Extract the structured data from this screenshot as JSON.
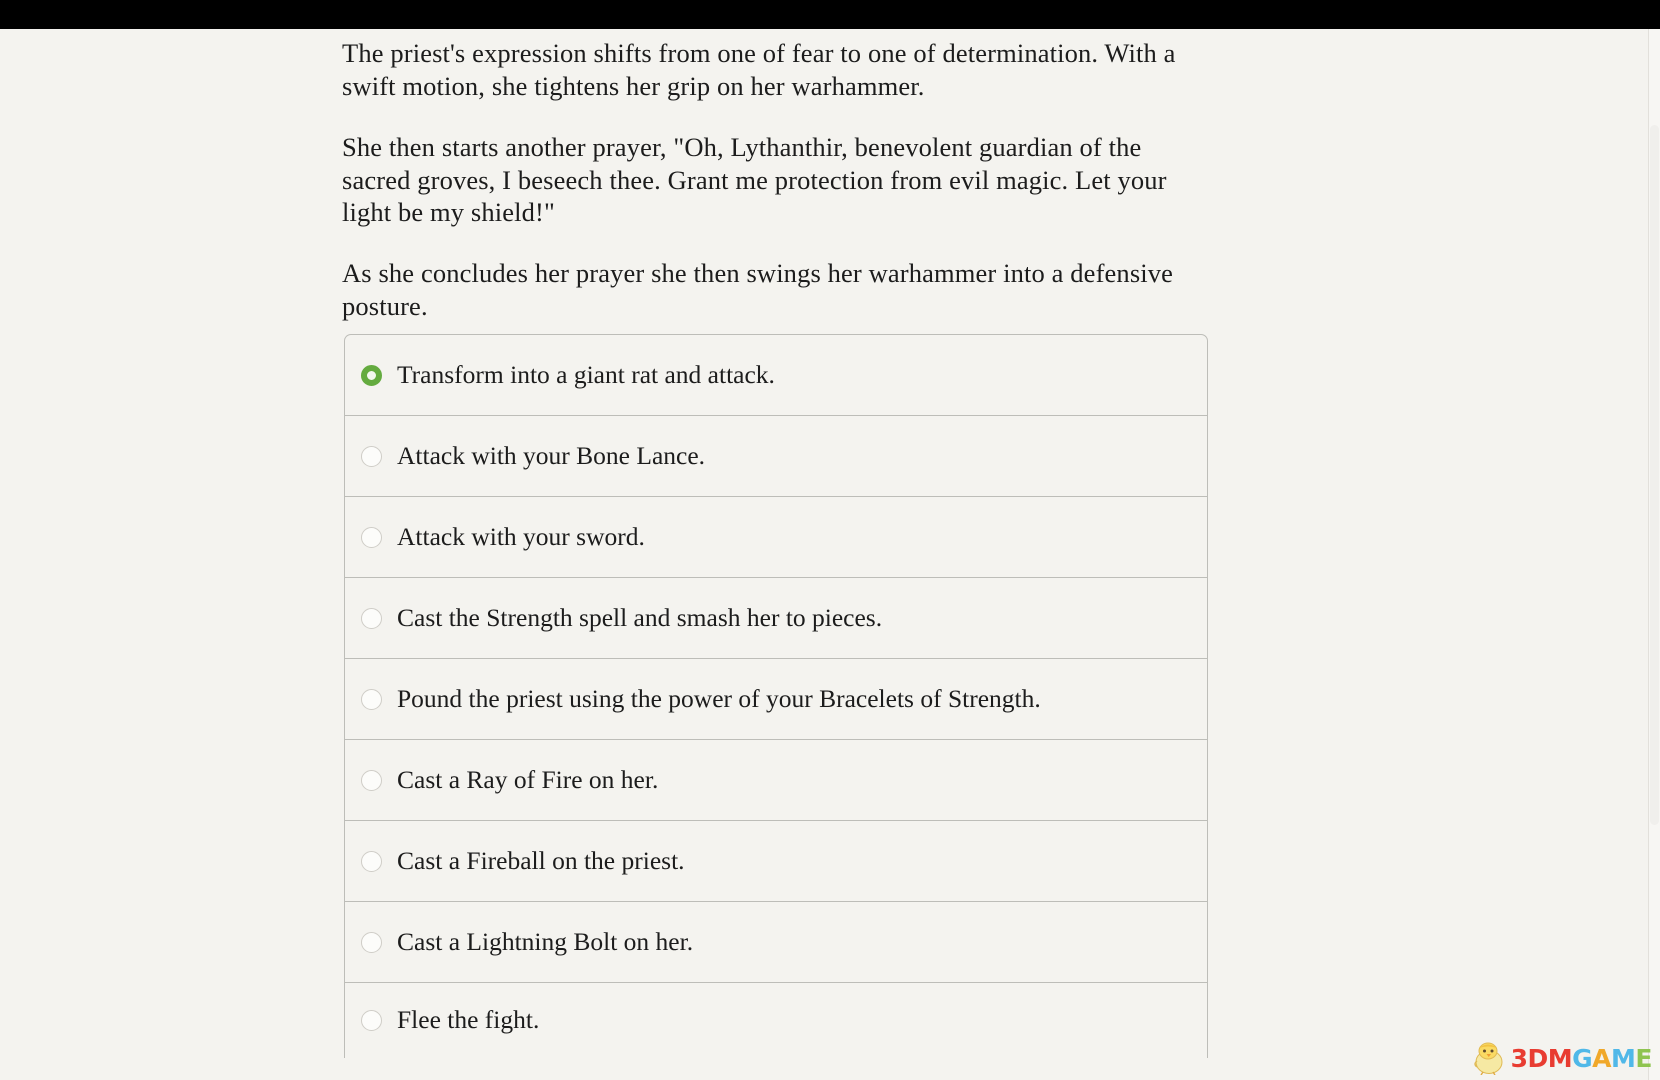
{
  "window": {
    "background_color": "#f4f3ef",
    "letterbox_color": "#000000"
  },
  "story": {
    "paragraphs": [
      "The priest's expression shifts from one of fear to one of determination. With a swift motion, she tightens her grip on her warhammer.",
      "She then starts another prayer, \"Oh, Lythanthir, benevolent guardian of the sacred groves, I beseech thee. Grant me protection from evil magic. Let your light be my shield!\"",
      "As she concludes her prayer she then swings her warhammer into a defensive posture."
    ]
  },
  "choices": {
    "selected_index": 0,
    "selected_color": "#64ab3f",
    "unselected_color": "#cfcdc7",
    "items": [
      {
        "label": "Transform into a giant rat and attack.",
        "selected": true
      },
      {
        "label": "Attack with your Bone Lance.",
        "selected": false
      },
      {
        "label": "Attack with your sword.",
        "selected": false
      },
      {
        "label": "Cast the Strength spell and smash her to pieces.",
        "selected": false
      },
      {
        "label": "Pound the priest using the power of your Bracelets of Strength.",
        "selected": false
      },
      {
        "label": "Cast a Ray of Fire on her.",
        "selected": false
      },
      {
        "label": "Cast a Fireball on the priest.",
        "selected": false
      },
      {
        "label": "Cast a Lightning Bolt on her.",
        "selected": false
      },
      {
        "label": "Flee the fight.",
        "selected": false
      }
    ]
  },
  "scrollbar": {
    "orientation": "vertical",
    "track_color": "#f7f6f3",
    "thumb_color": "#f0efec"
  },
  "watermark": {
    "text_part_1": "3DM",
    "text_part_2": "G",
    "text_part_3": "A",
    "text_part_4": "M",
    "text_part_5": "E",
    "color_1": "#e8352a",
    "color_2": "#4ab6e8"
  }
}
